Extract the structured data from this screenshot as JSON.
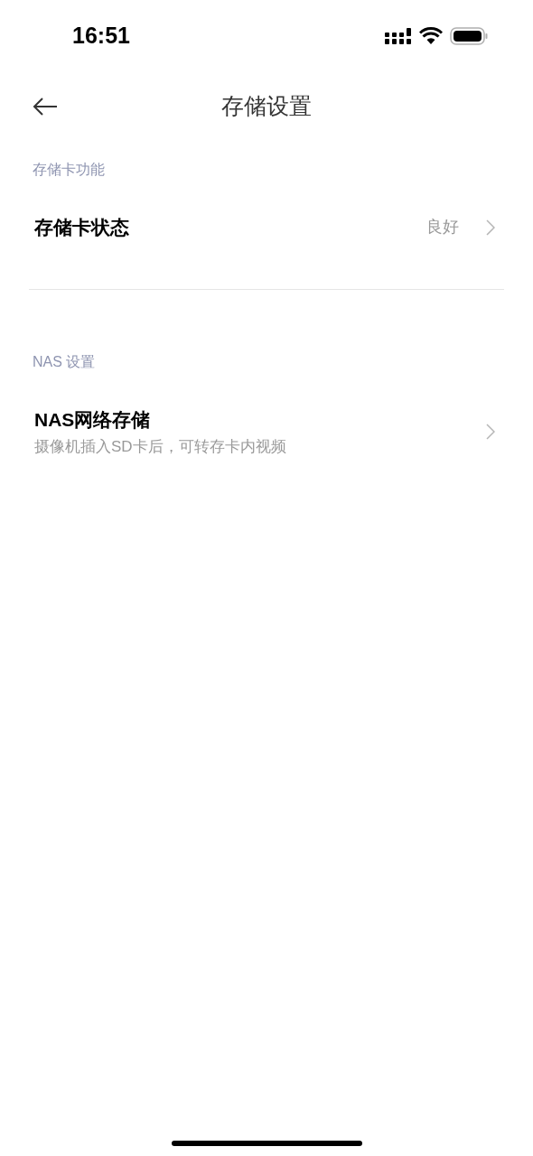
{
  "status_bar": {
    "time": "16:51"
  },
  "header": {
    "title": "存储设置"
  },
  "sections": [
    {
      "label": "存储卡功能",
      "items": [
        {
          "title": "存储卡状态",
          "value": "良好"
        }
      ]
    },
    {
      "label": "NAS 设置",
      "items": [
        {
          "title": "NAS网络存储",
          "subtitle": "摄像机插入SD卡后，可转存卡内视频"
        }
      ]
    }
  ]
}
